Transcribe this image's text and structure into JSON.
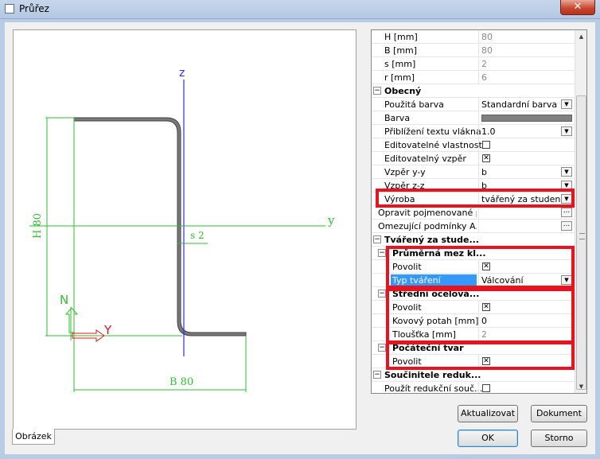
{
  "window": {
    "title": "Průřez",
    "close_icon": "close-icon"
  },
  "drawing": {
    "axis_z": "z",
    "axis_y": "y",
    "dim_h": "H 80",
    "dim_b": "B 80",
    "dim_s": "s 2",
    "origin_n": "N",
    "origin_y": "Y",
    "tab": "Obrázek",
    "colors": {
      "profile": "#6e6e6e",
      "axes": "#2a2aff",
      "dims": "#2fbf2f",
      "marker": "#e8131f"
    }
  },
  "grid": {
    "rows": [
      {
        "name": "H [mm]",
        "value": "80"
      },
      {
        "name": "B [mm]",
        "value": "80"
      },
      {
        "name": "s [mm]",
        "value": "2"
      },
      {
        "name": "r [mm]",
        "value": "6"
      },
      {
        "name": "Obecný"
      },
      {
        "name": "Použitá barva",
        "value": "Standardní barva"
      },
      {
        "name": "Barva"
      },
      {
        "name": "Přiblížení textu vlákna",
        "value": "1.0"
      },
      {
        "name": "Editovatelné vlastnosti"
      },
      {
        "name": "Editovatelný vzpěr"
      },
      {
        "name": "Vzpěr y-y",
        "value": "b"
      },
      {
        "name": "Vzpěr z-z",
        "value": "b"
      },
      {
        "name": "Výroba",
        "value": "tvářený za studena"
      },
      {
        "name": "Opravit pojmenované p..."
      },
      {
        "name": "Omezující podmínky A..."
      },
      {
        "name": "Tvářený za stude..."
      },
      {
        "name": "Průměrná mez kl..."
      },
      {
        "name": "Povolit"
      },
      {
        "name": "Typ tváření",
        "value": "Válcování"
      },
      {
        "name": "Střední ocelová..."
      },
      {
        "name": "Povolit"
      },
      {
        "name": "Kovový potah [mm]",
        "value": "0"
      },
      {
        "name": "Tloušťka [mm]",
        "value": "2"
      },
      {
        "name": "Počáteční tvar"
      },
      {
        "name": "Povolit"
      },
      {
        "name": "Součinitele reduk..."
      },
      {
        "name": "Použít redukční souč..."
      }
    ]
  },
  "buttons": {
    "update": "Aktualizovat",
    "document": "Dokument",
    "ok": "OK",
    "cancel": "Storno"
  },
  "highlight_color": "#e8131f"
}
